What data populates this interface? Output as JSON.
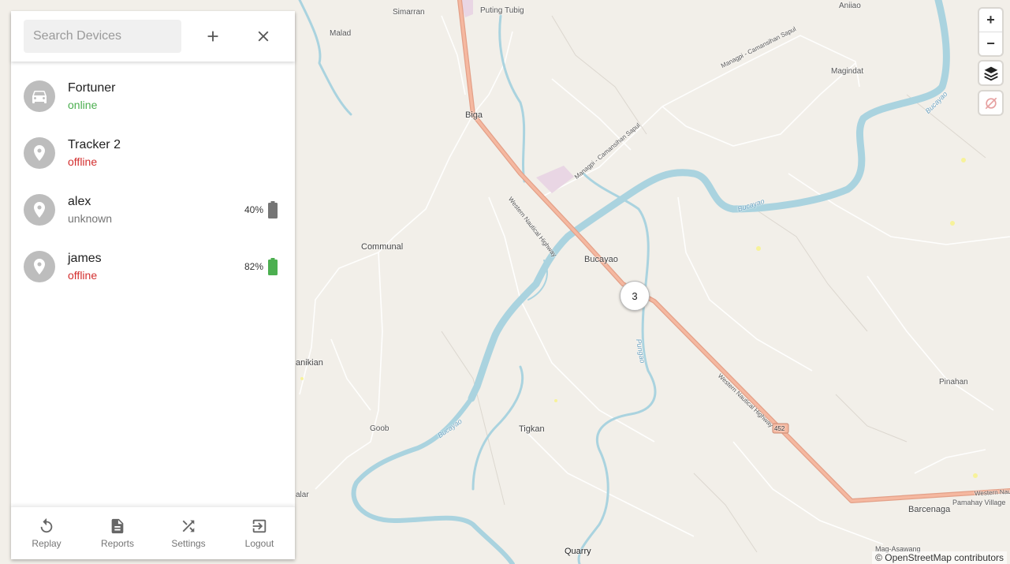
{
  "search": {
    "placeholder": "Search Devices"
  },
  "toolbar": {
    "add_icon": "plus-icon",
    "close_icon": "close-icon"
  },
  "devices": [
    {
      "name": "Fortuner",
      "status": "online",
      "status_color": "#4caf50",
      "icon": "car-icon",
      "battery": null
    },
    {
      "name": "Tracker 2",
      "status": "offline",
      "status_color": "#d32f2f",
      "icon": "location-pin-icon",
      "battery": null
    },
    {
      "name": "alex",
      "status": "unknown",
      "status_color": "#757575",
      "icon": "location-pin-icon",
      "battery": {
        "percent": "40%",
        "color": "#757575",
        "level": 0.4
      }
    },
    {
      "name": "james",
      "status": "offline",
      "status_color": "#d32f2f",
      "icon": "location-pin-icon",
      "battery": {
        "percent": "82%",
        "color": "#4caf50",
        "level": 0.82
      }
    }
  ],
  "nav": {
    "replay": "Replay",
    "reports": "Reports",
    "settings": "Settings",
    "logout": "Logout"
  },
  "map": {
    "cluster_count": "3",
    "attribution": "© OpenStreetMap contributors",
    "zoom_in": "+",
    "zoom_out": "−",
    "labels": {
      "simarran": "Simarran",
      "puting_tubig": "Puting Tubig",
      "aniiao": "Aniiao",
      "malad": "Malad",
      "magindat": "Magindat",
      "biga": "Biga",
      "bucayao": "Bucayao",
      "communal": "Communal",
      "anikian": "anikian",
      "goob": "Goob",
      "tigkan": "Tigkan",
      "pinahan": "Pinahan",
      "barcenaga": "Barcenaga",
      "pamahay": "Pamahay Village",
      "quarry": "Quarry",
      "mag_asawang": "Mag-Asawang",
      "alar": "alar",
      "highway_452": "452",
      "western_nautical_1": "Western Nautical Highway",
      "western_nautical_2": "Western Nautical Highway",
      "western_nau": "Western Nau",
      "managpi_1": "Managpi - Camansihan Sapul",
      "managpi_2": "Managpi - Camansihan Sapul",
      "bucayao_river_1": "Bucayao",
      "bucayao_river_2": "Bucayao",
      "bucayao_river_3": "Bucayao",
      "pungao": "Pungao"
    }
  }
}
